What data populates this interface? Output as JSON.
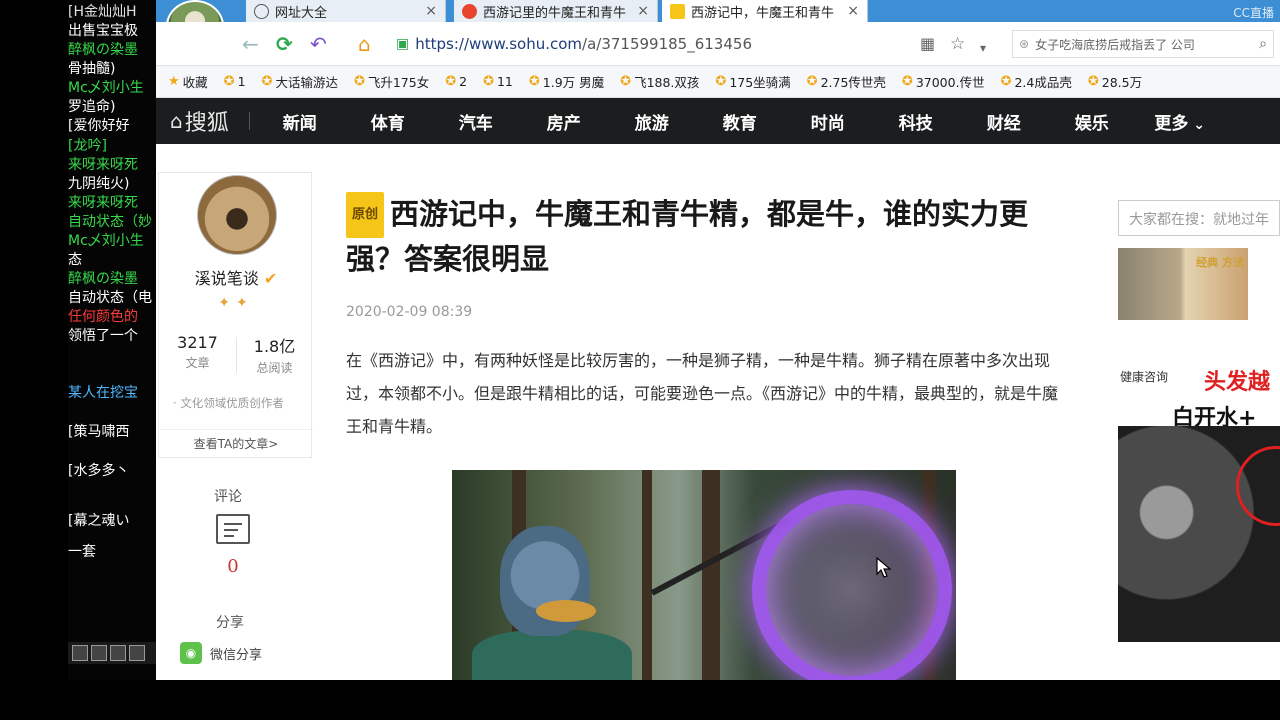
{
  "chat": {
    "lines": [
      {
        "text": "[H金灿灿H",
        "color": "#e0e0e0"
      },
      {
        "text": "出售宝宝极",
        "color": "#ffffff"
      },
      {
        "text": "醉枫の染墨",
        "color": "#36d94a"
      },
      {
        "text": "骨抽髓)",
        "color": "#ffffff"
      },
      {
        "text": "Mc乄刘小生",
        "color": "#36d94a"
      },
      {
        "text": "罗追命)",
        "color": "#ffffff"
      },
      {
        "text": "[爱你好好",
        "color": "#ffffff"
      },
      {
        "text": "[龙吟]",
        "color": "#36d94a"
      },
      {
        "text": "来呀来呀死",
        "color": "#36d94a"
      },
      {
        "text": "九阴纯火)",
        "color": "#ffffff"
      },
      {
        "text": "来呀来呀死",
        "color": "#36d94a"
      },
      {
        "text": "自动状态（妙",
        "color": "#36d94a"
      },
      {
        "text": "Mc乄刘小生",
        "color": "#36d94a"
      },
      {
        "text": "态",
        "color": "#ffffff"
      },
      {
        "text": "醉枫の染墨",
        "color": "#36d94a"
      },
      {
        "text": "自动状态（电",
        "color": "#ffffff"
      },
      {
        "text": "任何颜色的",
        "color": "#ff3b3b"
      },
      {
        "text": "领悟了一个",
        "color": "#ffffff"
      },
      {
        "text": "某人在挖宝",
        "color": "#4fb8ff"
      },
      {
        "text": "[策马啸西",
        "color": "#ffffff"
      },
      {
        "text": "[水多多丶",
        "color": "#ffffff"
      },
      {
        "text": "[幕之魂い",
        "color": "#ffffff"
      },
      {
        "text": "一套",
        "color": "#ffffff"
      }
    ]
  },
  "browser": {
    "tabs": [
      {
        "label": "网址大全",
        "icon": "globe-icon",
        "active": false
      },
      {
        "label": "西游记里的牛魔王和青牛",
        "icon": "sogou-icon",
        "active": false
      },
      {
        "label": "西游记中，牛魔王和青牛",
        "icon": "sohu-icon",
        "active": true
      }
    ],
    "live_badge": "CC直播",
    "url": {
      "scheme": "https://",
      "host": "www.sohu.com",
      "path": "/a/371599185_613456"
    },
    "search_text": "女子吃海底捞后戒指丢了 公司",
    "bookmarks": [
      "收藏",
      "1",
      "大话输游达",
      "飞升175女",
      "2",
      "11",
      "1.9万 男魔",
      "飞188.双孩",
      "175坐骑满",
      "2.75传世壳",
      "37000.传世",
      "2.4成品壳",
      "28.5万"
    ]
  },
  "site": {
    "logo": "搜狐",
    "channels": [
      "新闻",
      "体育",
      "汽车",
      "房产",
      "旅游",
      "教育",
      "时尚",
      "科技",
      "财经",
      "娱乐",
      "更多"
    ]
  },
  "author": {
    "name": "溪说笔谈",
    "articles_count": "3217",
    "articles_label": "文章",
    "reads_count": "1.8亿",
    "reads_label": "总阅读",
    "tag": "文化领域优质创作者",
    "view_articles": "查看TA的文章>"
  },
  "actions": {
    "comment_label": "评论",
    "comment_count": "0",
    "share_label": "分享",
    "wechat_share": "微信分享"
  },
  "article": {
    "badge": "原创",
    "title": "西游记中，牛魔王和青牛精，都是牛，谁的实力更强？答案很明显",
    "date": "2020-02-09 08:39",
    "body": "在《西游记》中，有两种妖怪是比较厉害的，一种是狮子精，一种是牛精。狮子精在原著中多次出现过，本领都不小。但是跟牛精相比的话，可能要逊色一点。《西游记》中的牛精，最典型的，就是牛魔王和青牛精。"
  },
  "sidebar": {
    "search_placeholder": "大家都在搜：就地过年",
    "ad_label": "健康咨询",
    "ad_headline": "头发越",
    "ad_sub": "白开水+",
    "ad_small_text": "经典\n方法"
  }
}
